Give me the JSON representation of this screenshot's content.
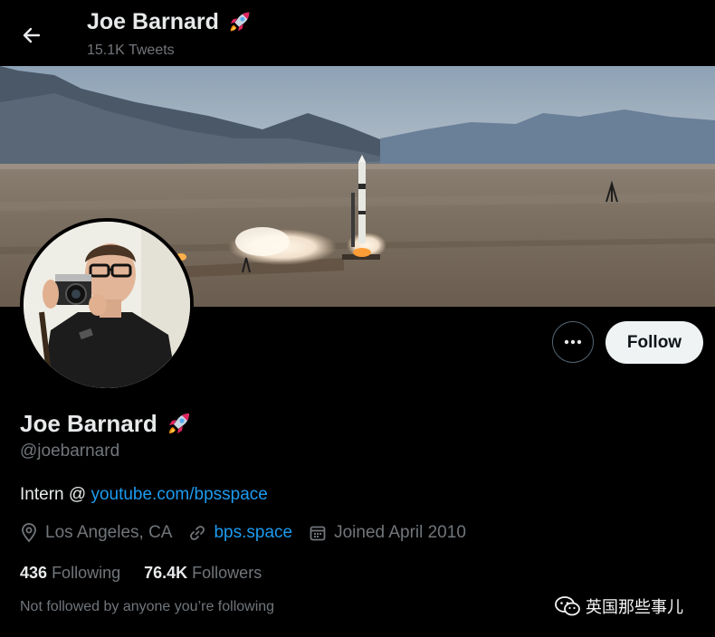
{
  "header": {
    "name": "Joe Barnard",
    "name_emoji": "rocket-icon",
    "tweet_count": "15.1K Tweets"
  },
  "profile": {
    "display_name": "Joe Barnard",
    "handle": "@joebarnard",
    "bio_prefix": "Intern @ ",
    "bio_link": "youtube.com/bpsspace",
    "location": "Los Angeles, CA",
    "website": "bps.space",
    "joined": "Joined April 2010",
    "following_count": "436",
    "following_label": "Following",
    "followers_count": "76.4K",
    "followers_label": "Followers",
    "not_followed_note": "Not followed by anyone you’re following"
  },
  "actions": {
    "follow_label": "Follow"
  },
  "watermark": {
    "text": "英国那些事儿"
  },
  "colors": {
    "link": "#1d9bf0",
    "secondary_text": "#71767b",
    "follow_button_bg": "#eff3f4"
  }
}
